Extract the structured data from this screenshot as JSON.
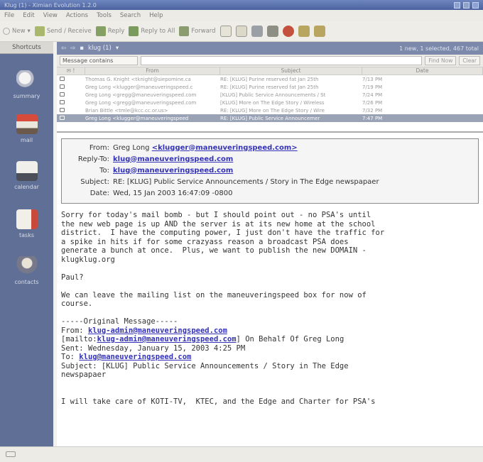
{
  "window": {
    "title": "Klug (1) - Ximian Evolution 1.2.0"
  },
  "menu": [
    "File",
    "Edit",
    "View",
    "Actions",
    "Tools",
    "Search",
    "Help"
  ],
  "toolbar": {
    "new": "New",
    "send_receive": "Send / Receive",
    "reply": "Reply",
    "reply_all": "Reply to All",
    "forward": "Forward"
  },
  "sidebar": {
    "header": "Shortcuts",
    "items": [
      "summary",
      "mail",
      "calendar",
      "tasks",
      "contacts"
    ]
  },
  "folder": {
    "name": "klug (1)",
    "status": "1 new, 1 selected, 467 total"
  },
  "search": {
    "mode": "Message contains",
    "find": "Find Now",
    "clear": "Clear"
  },
  "columns": {
    "from": "From",
    "subject": "Subject",
    "date": "Date"
  },
  "messages": [
    {
      "from": "Thomas G. Knight <tknight@siepomine.ca",
      "subject": "RE: [KLUG] Purine reserved fat Jan 25th",
      "date": "7/13 PM"
    },
    {
      "from": "Greg Long <klugger@maneuveringspeed.c",
      "subject": "RE: [KLUG] Purine reserved fat Jan 25th",
      "date": "7/19 PM"
    },
    {
      "from": "Greg Long <gregg@maneuveringspeed.com",
      "subject": "[KLUG] Public Service Announcements / St",
      "date": "7/24 PM"
    },
    {
      "from": "Greg Long <gregg@maneuveringspeed.com",
      "subject": "[KLUG] More on The Edge Story / Wireless",
      "date": "7/26 PM"
    },
    {
      "from": "Brian Bittle <tmle@kcc.cc.or.us>",
      "subject": "RE: [KLUG] More on The Edge Story / Wire",
      "date": "7/32 PM"
    },
    {
      "from": "Greg Long <klugger@maneuveringspeed",
      "subject": "RE: [KLUG] Public Service Announcemer",
      "date": "7:47 PM"
    }
  ],
  "header": {
    "from_label": "From:",
    "from_name": "Greg Long",
    "from_email": "<klugger@maneuveringspeed.com>",
    "replyto_label": "Reply-To:",
    "replyto": "klug@maneuveringspeed.com",
    "to_label": "To:",
    "to": "klug@maneuveringspeed.com",
    "subject_label": "Subject:",
    "subject": "RE: [KLUG] Public Service Announcements / Story in The Edge newspapaer",
    "date_label": "Date:",
    "date": "Wed, 15 Jan 2003 16:47:09 -0800"
  },
  "body": {
    "p1": "Sorry for today's mail bomb - but I should point out - no PSA's until\nthe new web page is up AND the server is at its new home at the school\ndistrict.  I have the computing power, I just don't have the traffic for\na spike in hits if for some crazyass reason a broadcast PSA does\ngenerate a bunch at once.  Plus, we want to publish the new DOMAIN -\nklugklug.org",
    "p2": "Paul?",
    "p3": "We can leave the mailing list on the maneuveringspeed box for now of\ncourse.",
    "orig": "-----Original Message-----",
    "from_label": "From: ",
    "from_link": "klug-admin@maneuveringspeed.com",
    "mailto_pre": "[mailto:",
    "mailto_link": "klug-admin@maneuveringspeed.com",
    "mailto_post": "] On Behalf Of Greg Long",
    "sent": "Sent: Wednesday, January 15, 2003 4:25 PM",
    "to_label": "To: ",
    "to_link": "klug@maneuveringspeed.com",
    "subject": "Subject: [KLUG] Public Service Announcements / Story in The Edge\nnewspapaer",
    "last": "I will take care of KOTI-TV,  KTEC, and the Edge and Charter for PSA's"
  },
  "colors": {
    "sidebar": "#5f6f95",
    "folderbar": "#7c89ab",
    "link": "#3433b8",
    "selected_row": "#9aa2b5"
  }
}
